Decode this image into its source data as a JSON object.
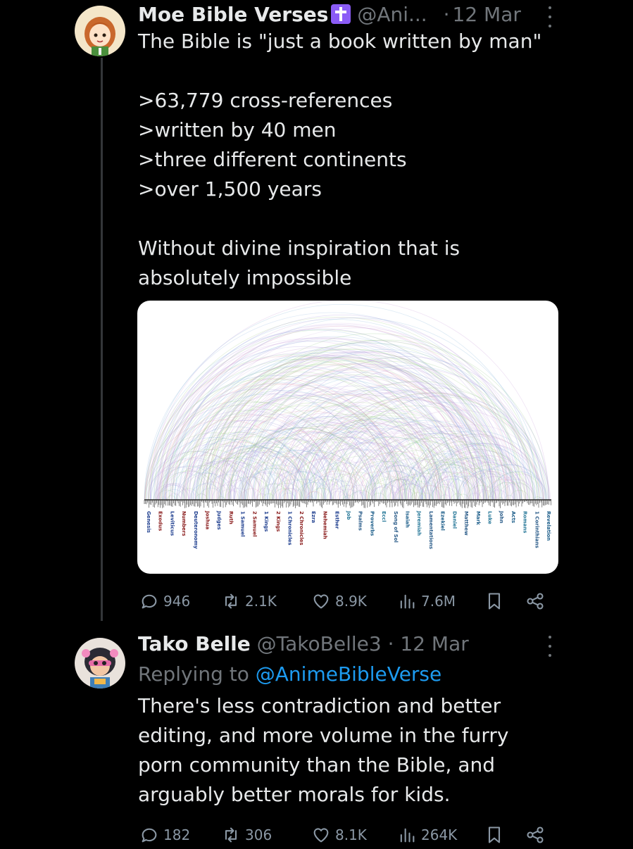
{
  "tweet1": {
    "display_name": "Moe Bible Verses",
    "badge_icon": "latin-cross-icon",
    "handle": "@Ani...",
    "separator": "·",
    "time": "12 Mar",
    "text": "The Bible is \"just a book written by man\"\n\n>63,779 cross-references\n>written by 40 men\n>three different continents\n>over 1,500 years\n\nWithout divine inspiration that is\nabsolutely impossible",
    "stats": {
      "replies": "946",
      "reposts": "2.1K",
      "likes": "8.9K",
      "views": "7.6M"
    }
  },
  "tweet2": {
    "display_name": "Tako Belle",
    "handle": "@TakoBelle3",
    "separator": "·",
    "time": "12 Mar",
    "replying_label": "Replying to ",
    "replying_handle": "@AnimeBibleVerse",
    "text": "There's less contradiction and better\nediting, and more volume in the furry\nporn community than the Bible, and\narguably better morals for kids.",
    "stats": {
      "replies": "182",
      "reposts": "306",
      "likes": "8.1K",
      "views": "264K"
    }
  },
  "arc_diagram": {
    "books": [
      "Genesis",
      "Exodus",
      "Leviticus",
      "Numbers",
      "Deuteronomy",
      "Joshua",
      "Judges",
      "Ruth",
      "1 Samuel",
      "2 Samuel",
      "1 Kings",
      "2 Kings",
      "1 Chronicles",
      "2 Chronicles",
      "Ezra",
      "Nehemiah",
      "Esther",
      "Job",
      "Psalms",
      "Proverbs",
      "Eccl",
      "Song of Sol",
      "Isaiah",
      "Jeremiah",
      "Lamentations",
      "Ezekiel",
      "Daniel",
      "Matthew",
      "Mark",
      "Luke",
      "John",
      "Acts",
      "Romans",
      "1 Corinthians",
      "Revelation"
    ]
  },
  "colors": {
    "background": "#000000",
    "text": "#e7e9ea",
    "muted": "#71767b",
    "link": "#1d9bf0",
    "badge": "#8b5cf6"
  }
}
